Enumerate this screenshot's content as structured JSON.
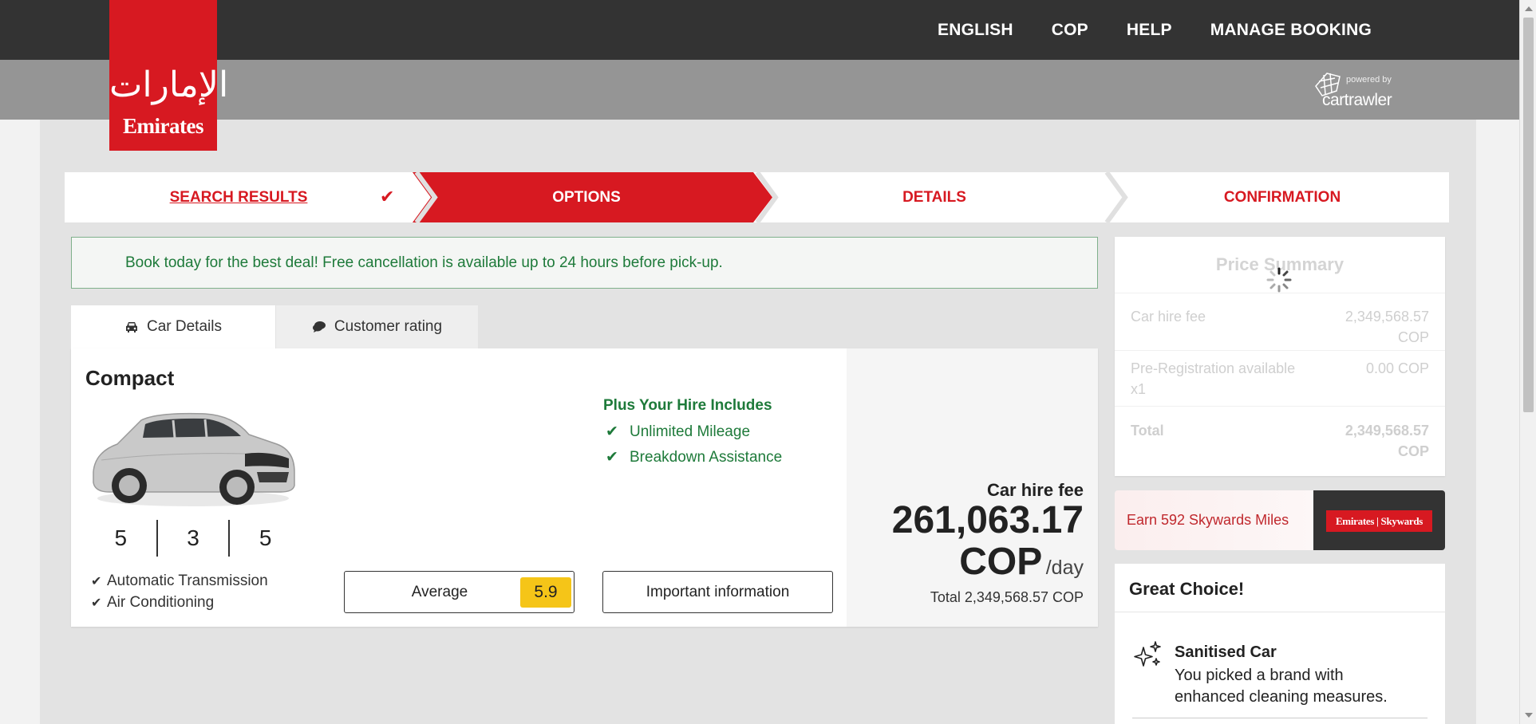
{
  "header": {
    "nav": [
      "ENGLISH",
      "COP",
      "HELP",
      "MANAGE BOOKING"
    ],
    "powered_by": "powered by",
    "partner": "cartrawler"
  },
  "logo": {
    "brand": "Emirates",
    "arabic": "الإمارات"
  },
  "steps": [
    {
      "label": "SEARCH RESULTS",
      "state": "done"
    },
    {
      "label": "OPTIONS",
      "state": "active"
    },
    {
      "label": "DETAILS",
      "state": "upcoming"
    },
    {
      "label": "CONFIRMATION",
      "state": "upcoming"
    }
  ],
  "deal_banner": "Book today for the best deal! Free cancellation is available up to 24 hours before pick-up.",
  "tabs": [
    {
      "label": "Car Details",
      "icon": "car-icon"
    },
    {
      "label": "Customer rating",
      "icon": "chat-icon"
    }
  ],
  "car": {
    "class": "Compact",
    "specs": [
      "5",
      "3",
      "5"
    ],
    "features": [
      "Automatic Transmission",
      "Air Conditioning"
    ],
    "includes_title": "Plus Your Hire Includes",
    "includes": [
      "Unlimited Mileage",
      "Breakdown Assistance"
    ],
    "rating_label": "Average",
    "rating_score": "5.9",
    "info_button": "Important information"
  },
  "price": {
    "label": "Car hire fee",
    "amount": "261,063.17",
    "currency": "COP",
    "per": "/day",
    "total": "Total 2,349,568.57 COP"
  },
  "summary": {
    "title": "Price Summary",
    "rows": [
      {
        "label": "Car hire fee",
        "value": "2,349,568.57 COP"
      },
      {
        "label": "Pre-Registration available x1",
        "value": "0.00 COP"
      },
      {
        "label": "Total",
        "value": "2,349,568.57 COP"
      }
    ]
  },
  "skywards": {
    "text": "Earn 592 Skywards Miles",
    "badge": "Emirates | Skywards"
  },
  "great_choice": {
    "title": "Great Choice!",
    "feature_title": "Sanitised Car",
    "feature_desc": "You picked a brand with enhanced cleaning measures."
  },
  "colors": {
    "brand_red": "#d71921",
    "header_dark": "#333333",
    "subheader_grey": "#959595",
    "success_green": "#1e7a3a",
    "rating_yellow": "#f5c518"
  }
}
